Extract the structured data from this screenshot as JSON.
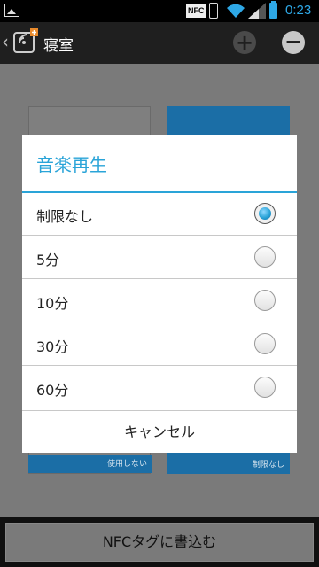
{
  "status_bar": {
    "time": "0:23",
    "nfc_label": "NFC"
  },
  "action_bar": {
    "title": "寝室",
    "back_icon": "chevron-left-icon",
    "app_icon": "nfc-tag-icon"
  },
  "tiles": {
    "left": {
      "footer": "使用しない"
    },
    "right": {
      "footer": "制限なし"
    }
  },
  "dialog": {
    "title": "音楽再生",
    "options": [
      {
        "label": "制限なし",
        "checked": true
      },
      {
        "label": "5分",
        "checked": false
      },
      {
        "label": "10分",
        "checked": false
      },
      {
        "label": "30分",
        "checked": false
      },
      {
        "label": "60分",
        "checked": false
      }
    ],
    "cancel_label": "キャンセル"
  },
  "bottom": {
    "write_label": "NFCタグに書込む"
  },
  "colors": {
    "accent": "#2aa4d8",
    "tile_blue": "#1b6ea6"
  }
}
